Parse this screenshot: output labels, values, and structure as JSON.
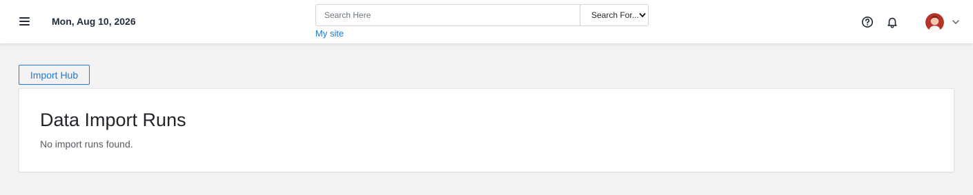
{
  "header": {
    "date": "Mon, Aug 10, 2026",
    "search": {
      "placeholder": "Search Here",
      "value": "",
      "select_value": "Search For..."
    },
    "my_site_label": "My site",
    "icons": [
      "menu-icon",
      "help-icon",
      "bell-icon",
      "avatar",
      "chevron-down-icon"
    ]
  },
  "main": {
    "import_hub_label": "Import Hub",
    "card": {
      "title": "Data Import Runs",
      "empty_message": "No import runs found."
    }
  },
  "colors": {
    "accent": "#1a7bd8",
    "background": "#f2f2f2",
    "surface": "#ffffff"
  }
}
